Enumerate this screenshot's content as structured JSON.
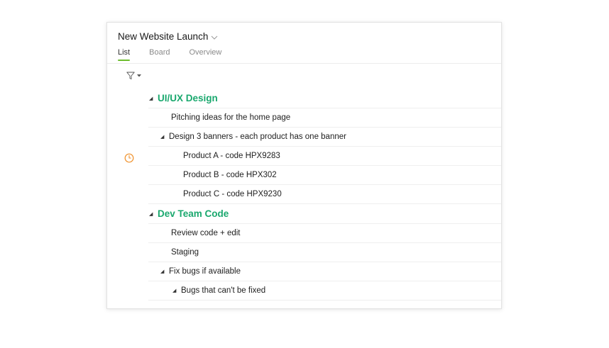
{
  "project": {
    "title": "New Website Launch"
  },
  "tabs": [
    {
      "label": "List",
      "active": true
    },
    {
      "label": "Board",
      "active": false
    },
    {
      "label": "Overview",
      "active": false
    }
  ],
  "colors": {
    "accent_green": "#1aa86e",
    "tab_underline": "#6dbd2e",
    "clock_orange": "#f0922c"
  },
  "icons": {
    "filter": "filter-icon",
    "clock": "clock-icon",
    "collapse": "triangle-down-icon",
    "dropdown": "chevron-down-icon"
  },
  "groups": [
    {
      "title": "UI/UX Design",
      "tasks": [
        {
          "label": "Pitching ideas for the home page"
        },
        {
          "label": "Design 3 banners - each product has one banner",
          "subtasks": [
            {
              "label": "Product A - code HPX9283"
            },
            {
              "label": "Product B - code HPX302"
            },
            {
              "label": "Product C - code HPX9230"
            }
          ]
        }
      ]
    },
    {
      "title": "Dev Team Code",
      "tasks": [
        {
          "label": "Review code + edit"
        },
        {
          "label": "Staging"
        },
        {
          "label": "Fix bugs if available",
          "subtasks": [
            {
              "label": "Bugs that can't be fixed"
            }
          ]
        }
      ]
    }
  ]
}
